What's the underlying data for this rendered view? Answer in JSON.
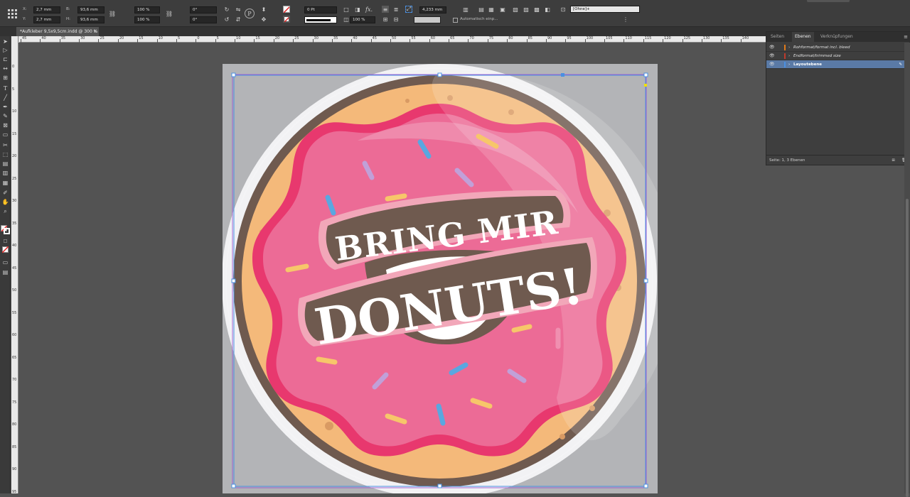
{
  "control_panel": {
    "x_label": "X:",
    "x_value": "2,7 mm",
    "y_label": "Y:",
    "y_value": "2,7 mm",
    "w_label": "B:",
    "w_value": "93,6 mm",
    "h_label": "H:",
    "h_value": "93,6 mm",
    "scale_x": "100 %",
    "scale_y": "100 %",
    "rotate": "0°",
    "shear": "0°",
    "stroke_weight": "0 Pt",
    "opacity": "100 %",
    "dim_value": "4,233 mm",
    "autofit_label": "Automatisch einp...",
    "object_style": "[Ohne]+"
  },
  "document_tab": {
    "title": "*Aufkleber 9,5x9,5cm.indd @ 300 %",
    "close": "×"
  },
  "rulers": {
    "h_ticks": [
      "45",
      "40",
      "35",
      "30",
      "25",
      "20",
      "15",
      "10",
      "5",
      "0",
      "5",
      "10",
      "15",
      "20",
      "25",
      "30",
      "35",
      "40",
      "45",
      "50",
      "55",
      "60",
      "65",
      "70",
      "75",
      "80",
      "85",
      "90",
      "95",
      "100",
      "105",
      "110",
      "115",
      "120",
      "125",
      "130",
      "135",
      "140"
    ],
    "v_ticks": [
      "0",
      "5",
      "10",
      "15",
      "20",
      "25",
      "30",
      "35",
      "40",
      "45",
      "50",
      "55",
      "60",
      "65",
      "70",
      "75",
      "80",
      "85",
      "90",
      "95"
    ]
  },
  "artwork": {
    "line1": "BRING MIR",
    "line2": "DONUTS!",
    "colors": {
      "page_bg": "#b3b4b7",
      "sticker_white": "#f2f2f4",
      "outer_ring": "#6f5a4f",
      "dough": "#f4b97a",
      "glaze_outline": "#e8386e",
      "glaze": "#ec6b96",
      "glaze_light": "#f08fb0",
      "banner": "#6f5a4f",
      "banner_outline": "#f2a7b9",
      "text": "#ffffff",
      "frame_purple": "#9b59d0",
      "frame_blue": "#4a90e2"
    }
  },
  "layers_panel": {
    "tabs": [
      "Seiten",
      "Ebenen",
      "Verknüpfungen"
    ],
    "active_tab": "Ebenen",
    "layers": [
      {
        "name": "Rohformat/format incl. bleed",
        "color": "#e07a1a",
        "selected": false
      },
      {
        "name": "Endformat/trimmed size",
        "color": "#c0392b",
        "selected": false
      },
      {
        "name": "Layoutebene",
        "color": "#4a90e2",
        "selected": true
      }
    ],
    "footer": "Seite: 1, 3 Ebenen"
  }
}
